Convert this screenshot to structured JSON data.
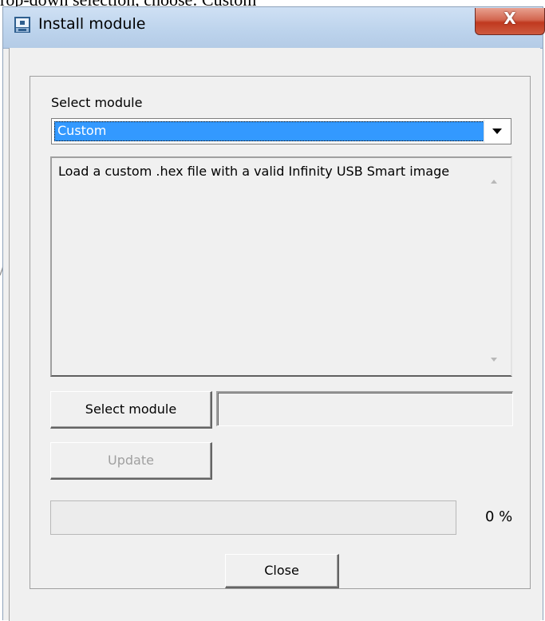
{
  "document": {
    "caption": "rop-down selection, choose: Custom"
  },
  "window": {
    "title": "Install module",
    "close_glyph": "X",
    "app_icon": "install-module-app-icon"
  },
  "form": {
    "select_module_label": "Select module",
    "module_dropdown": {
      "selected_value": "Custom"
    },
    "description_text": "Load a custom .hex file with a valid Infinity USB Smart image",
    "select_module_button": "Select module",
    "module_path_value": "",
    "update_button": "Update",
    "update_enabled": false,
    "progress": {
      "fraction": 0.0,
      "percent_label": "0 %"
    },
    "close_button": "Close"
  },
  "colors": {
    "selection_highlight": "#3399ff",
    "titlebar": "#bcd3ec",
    "close_button": "#c0391f",
    "window_background": "#f0f0f0"
  },
  "icons": [
    "install-module-app-icon",
    "close-icon",
    "chevron-down-icon",
    "scroll-up-icon",
    "scroll-down-icon"
  ]
}
